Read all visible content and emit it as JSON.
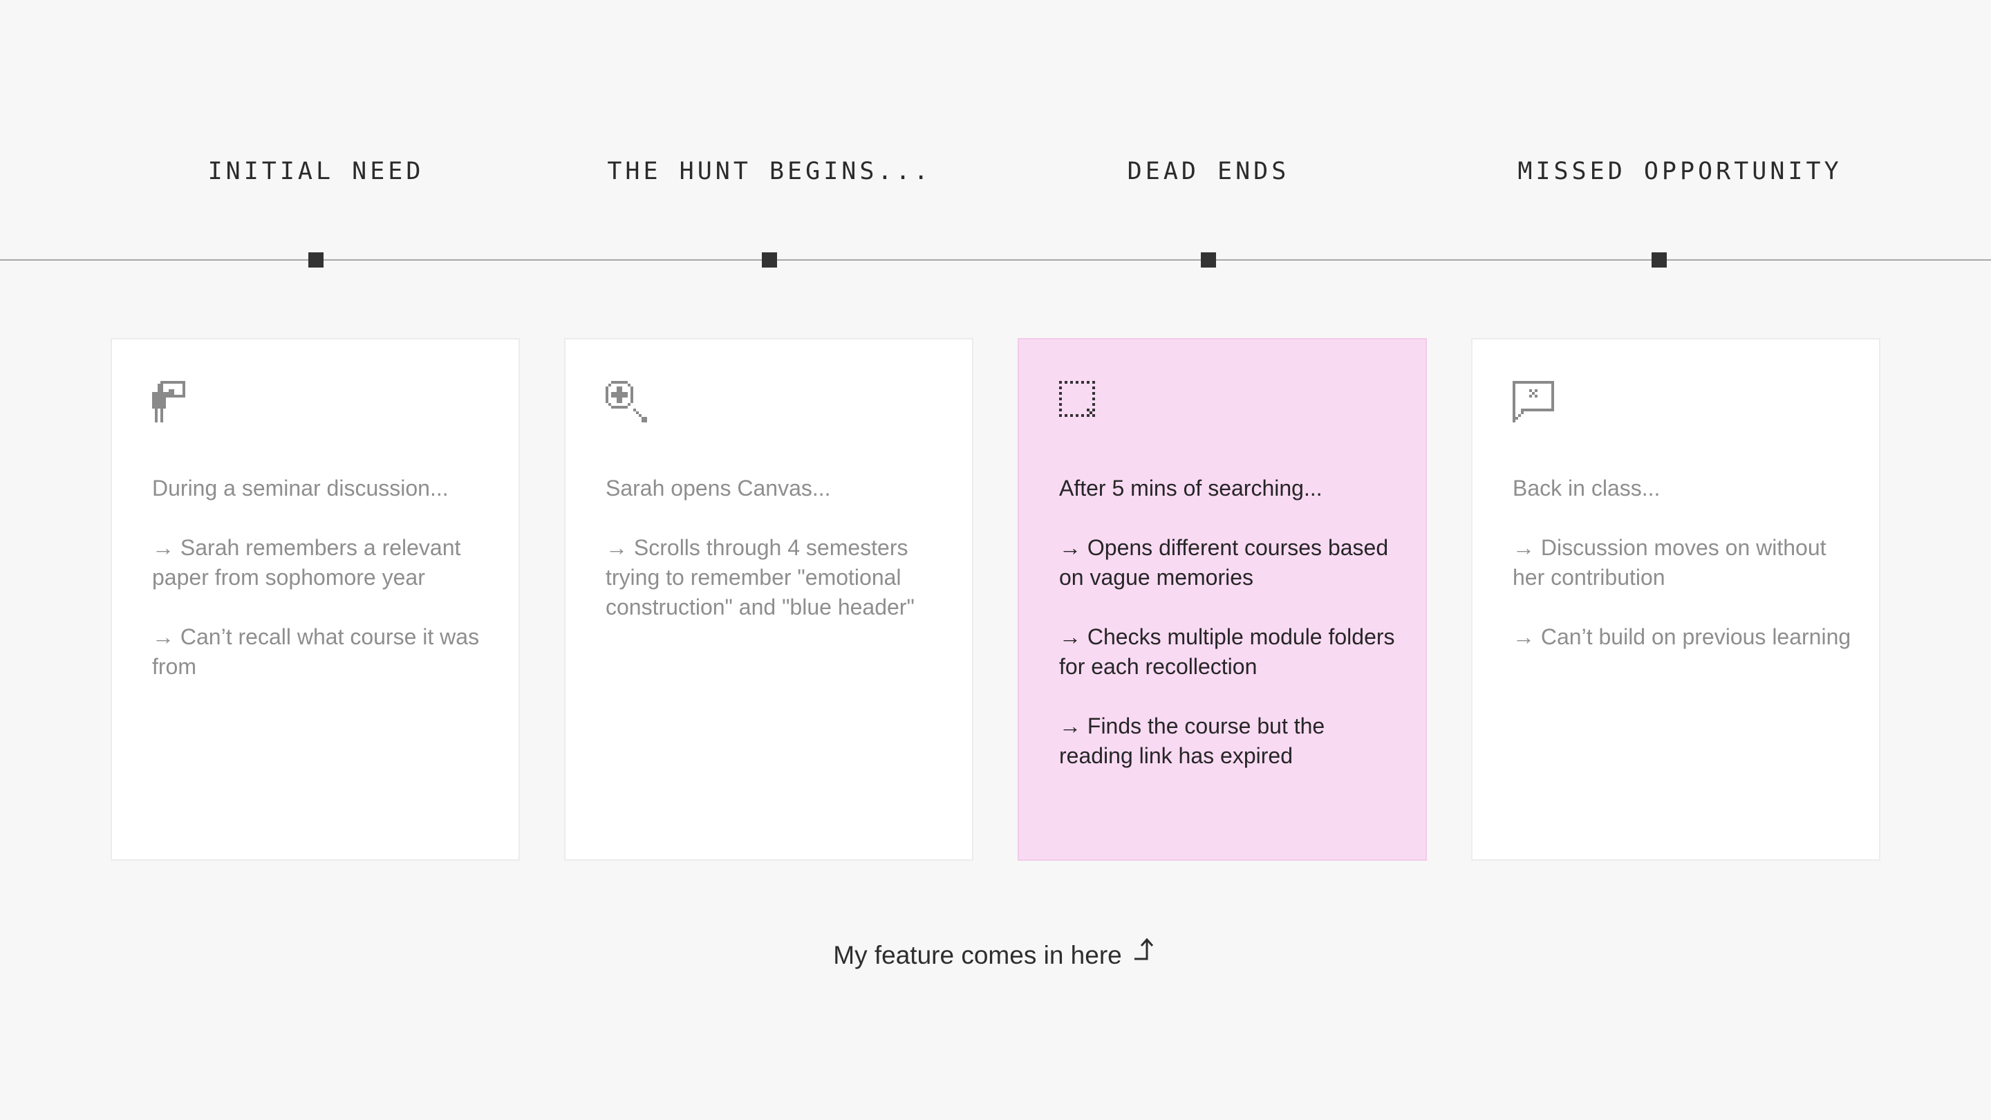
{
  "stages": [
    {
      "title": "INITIAL NEED",
      "icon": "presenter-icon",
      "intro": "During a seminar discussion...",
      "points": [
        "→ Sarah remembers a relevant paper from sophomore year",
        "→ Can’t recall what course it was from"
      ]
    },
    {
      "title": "THE HUNT BEGINS...",
      "icon": "zoom-in-icon",
      "intro": "Sarah opens Canvas...",
      "points": [
        "→ Scrolls through 4 semesters trying to remember \"emotional construction\" and \"blue header\""
      ]
    },
    {
      "title": "DEAD ENDS",
      "icon": "dashed-selection-icon",
      "intro": "After 5 mins of searching...",
      "points": [
        "→ Opens different courses based on vague memories",
        "→ Checks multiple module folders for each recollection",
        "→ Finds the course but the reading link has expired"
      ],
      "highlight_color": "#f9daf3"
    },
    {
      "title": "MISSED OPPORTUNITY",
      "icon": "message-x-icon",
      "intro": "Back in class...",
      "points": [
        "→ Discussion moves on without her contribution",
        "→ Can’t build on previous learning"
      ]
    }
  ],
  "footer": {
    "note": "My feature comes in here",
    "icon": "corner-up-arrow-icon"
  },
  "colors": {
    "background": "#f7f7f7",
    "highlight": "#f9daf3",
    "marker": "#333333",
    "muted_text": "#8e8e8e",
    "dark_text": "#262626"
  }
}
